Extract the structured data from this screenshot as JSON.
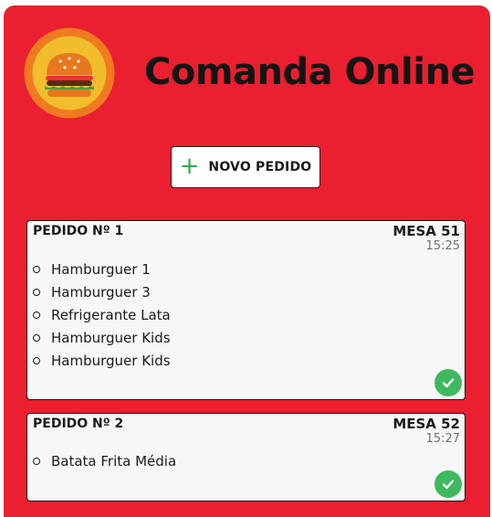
{
  "app": {
    "title": "Comanda Online",
    "logo_icon": "hamburger-logo",
    "brand_color": "#ea1f2f"
  },
  "toolbar": {
    "new_order_label": "NOVO PEDIDO",
    "new_order_icon": "plus-icon"
  },
  "orders": [
    {
      "label": "PEDIDO Nº 1",
      "table": "MESA 51",
      "time": "15:25",
      "items": [
        "Hamburguer 1",
        "Hamburguer 3",
        "Refrigerante Lata",
        "Hamburguer Kids",
        "Hamburguer Kids"
      ],
      "action_icon": "check-circle-icon"
    },
    {
      "label": "PEDIDO Nº 2",
      "table": "MESA 52",
      "time": "15:27",
      "items": [
        "Batata Frita Média"
      ],
      "action_icon": "check-circle-icon"
    }
  ]
}
